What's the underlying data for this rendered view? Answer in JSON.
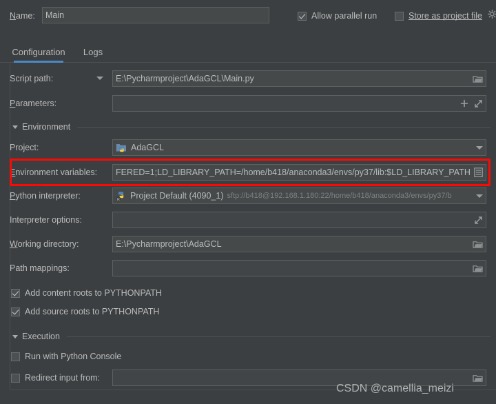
{
  "window": {
    "app": "PyCharm Run/Debug Configurations",
    "background_color": "#3c3f41",
    "accent_color": "#4a88c7",
    "highlight_color": "#fb0a05"
  },
  "header": {
    "name_label": "Name:",
    "name_value": "Main",
    "allow_parallel_run_label": "Allow parallel run",
    "allow_parallel_run_checked": true,
    "store_as_project_file_label": "Store as project file",
    "store_as_project_file_checked": false,
    "gear_icon": "gear-icon"
  },
  "tabs": [
    {
      "label": "Configuration",
      "active": true
    },
    {
      "label": "Logs",
      "active": false
    }
  ],
  "form": {
    "script_path": {
      "label": "Script path:",
      "value": "E:\\Pycharmproject\\AdaGCL\\Main.py",
      "dropdown_icon": "chevron-down-icon",
      "browse_icon": "folder-icon"
    },
    "parameters": {
      "label": "Parameters:",
      "value": "",
      "add_icon": "plus-icon",
      "expand_icon": "expand-icon"
    }
  },
  "environment_section": {
    "title": "Environment",
    "collapse_icon": "triangle-down-icon",
    "project": {
      "label": "Project:",
      "value": "AdaGCL",
      "icon": "python-project-folder-icon",
      "dropdown_icon": "chevron-down-icon"
    },
    "environment_variables": {
      "label": "Environment variables:",
      "label_mnemonic": "E",
      "value": "FERED=1;LD_LIBRARY_PATH=/home/b418/anaconda3/envs/py37/lib:$LD_LIBRARY_PATH",
      "edit_icon": "list-edit-icon",
      "highlighted": true
    },
    "python_interpreter": {
      "label": "Python interpreter:",
      "label_mnemonic": "P",
      "value": "Project Default (4090_1)",
      "value_secondary": "sftp://b418@192.168.1.180:22/home/b418/anaconda3/envs/py37/b",
      "icon": "python-remote-interpreter-icon",
      "dropdown_icon": "chevron-down-icon"
    },
    "interpreter_options": {
      "label": "Interpreter options:",
      "value": "",
      "expand_icon": "expand-icon"
    },
    "working_directory": {
      "label": "Working directory:",
      "label_mnemonic": "W",
      "value": "E:\\Pycharmproject\\AdaGCL",
      "browse_icon": "folder-icon"
    },
    "path_mappings": {
      "label": "Path mappings:",
      "value": "",
      "browse_icon": "folder-icon"
    },
    "add_content_roots": {
      "label": "Add content roots to PYTHONPATH",
      "checked": true
    },
    "add_source_roots": {
      "label": "Add source roots to PYTHONPATH",
      "checked": true
    }
  },
  "execution_section": {
    "title": "Execution",
    "collapse_icon": "triangle-down-icon",
    "run_with_python_console": {
      "label": "Run with Python Console",
      "checked": false
    },
    "redirect_input_from": {
      "label": "Redirect input from:",
      "checked": false,
      "value": "",
      "browse_icon": "folder-icon"
    }
  },
  "watermark": {
    "text": "CSDN @camellia_meizi"
  }
}
